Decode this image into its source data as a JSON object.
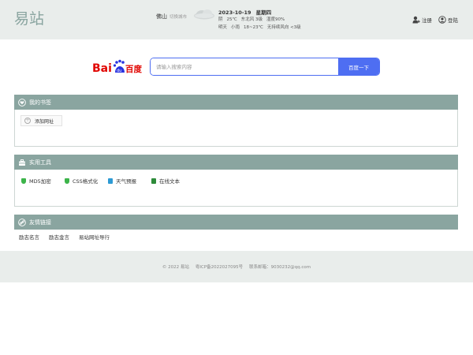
{
  "header": {
    "logo_text": "易站",
    "city": "佛山",
    "switch_city": "切换城市",
    "weather_icon": "cloud-icon",
    "today": {
      "date": "2023-10-19",
      "weekday": "星期四",
      "condition": "阴",
      "temp": "25℃",
      "wind": "东北风 3级",
      "humidity": "湿度90%"
    },
    "tomorrow": {
      "label": "明天",
      "condition": "小雨",
      "temp": "18~23℃",
      "wind": "无持续风向 <3级"
    },
    "register_label": "注册",
    "login_label": "登陆"
  },
  "search": {
    "engine_logo_text": "百度",
    "placeholder": "请输入搜索内容",
    "button_label": "百度一下",
    "brand_color": "#4e6ef2"
  },
  "bookmarks": {
    "title": "我的书签",
    "add_label": "添加网址"
  },
  "tools": {
    "title": "实用工具",
    "items": [
      {
        "label": "MD5加密",
        "icon": "shield-icon",
        "color": "#3cb44a"
      },
      {
        "label": "CSS格式化",
        "icon": "css-icon",
        "color": "#3cb44a"
      },
      {
        "label": "天气预报",
        "icon": "weather-icon",
        "color": "#2d9ad4"
      },
      {
        "label": "在线文本",
        "icon": "text-icon",
        "color": "#2e8b3a"
      }
    ]
  },
  "links": {
    "title": "友情链接",
    "items": [
      "励志名言",
      "励志金言",
      "易站网址导行"
    ]
  },
  "footer": {
    "copyright": "© 2022 易站",
    "icp": "粤ICP备2022027095号",
    "contact": "联系邮箱：9030232@qq.com"
  },
  "colors": {
    "header_bg": "#e9edeb",
    "panel_head": "#8aa5a0"
  }
}
